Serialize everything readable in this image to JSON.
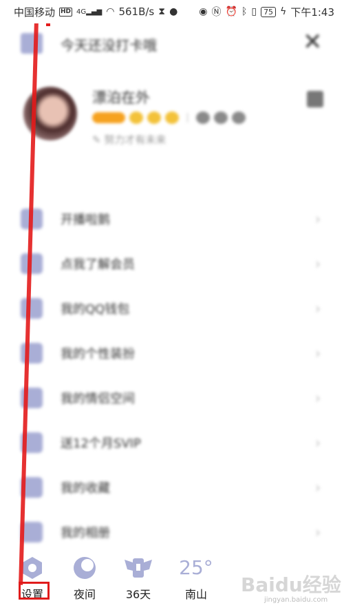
{
  "status_bar": {
    "carrier": "中国移动",
    "hd": "HD",
    "network": "4G",
    "speed": "561B/s",
    "battery": "75",
    "time": "下午1:43"
  },
  "header": {
    "checkin_text": "今天还没打卡哦",
    "close_glyph": "✕"
  },
  "profile": {
    "username": "漂泊在外",
    "signature": "努力才有未来"
  },
  "menu": {
    "items": [
      {
        "label": "开播啦鹅",
        "icon": "live-icon"
      },
      {
        "label": "点我了解会员",
        "icon": "vip-icon"
      },
      {
        "label": "我的QQ钱包",
        "icon": "wallet-icon"
      },
      {
        "label": "我的个性装扮",
        "icon": "shirt-icon"
      },
      {
        "label": "我的情侣空间",
        "icon": "heart-icon"
      },
      {
        "label": "送12个月SVIP",
        "icon": "gift-icon"
      },
      {
        "label": "我的收藏",
        "icon": "bookmark-icon"
      },
      {
        "label": "我的相册",
        "icon": "album-icon"
      }
    ],
    "chevron": "›"
  },
  "bottom_bar": {
    "settings_label": "设置",
    "night_label": "夜间",
    "days_label": "36天",
    "temperature": "25°",
    "city_label": "南山"
  },
  "watermark": {
    "main": "Baidu经验",
    "sub": "jingyan.baidu.com"
  },
  "colors": {
    "accent": "#a9aed6",
    "highlight": "#e01b1b"
  }
}
